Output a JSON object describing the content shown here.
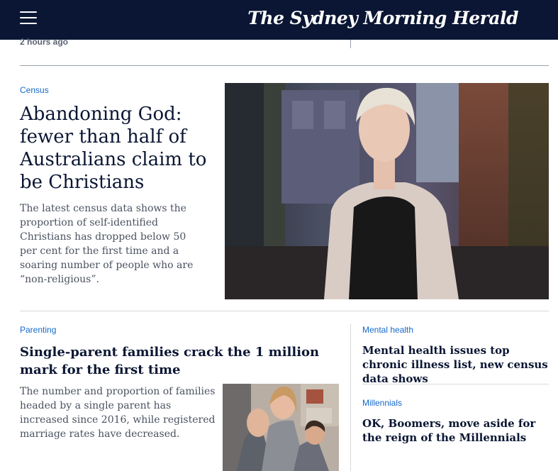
{
  "header": {
    "masthead": "The Sydney Morning Herald",
    "menu_icon": "hamburger-menu-icon",
    "background_color": "#0a1633"
  },
  "previous_story": {
    "timestamp": "2 hours ago"
  },
  "lead_story": {
    "kicker": "Census",
    "headline": "Abandoning God: fewer than half of Australians claim to be Christians",
    "summary": "The latest census data shows the proportion of self-identified Christians has dropped below 50 per cent for the first time and a soaring number of people who are “non-religious”."
  },
  "secondary_story": {
    "kicker": "Parenting",
    "headline": "Single-parent families crack the 1 million mark for the first time",
    "summary": "The number and proportion of families headed by a single parent has increased since 2016, while registered marriage rates have decreased."
  },
  "side_stories": [
    {
      "kicker": "Mental health",
      "headline": "Mental health issues top chronic illness list, new census data shows"
    },
    {
      "kicker": "Millennials",
      "headline": "OK, Boomers, move aside for the reign of the Millennials"
    }
  ],
  "colors": {
    "kicker": "#1469c9",
    "headline": "#0a1633",
    "summary": "#4a5260"
  }
}
